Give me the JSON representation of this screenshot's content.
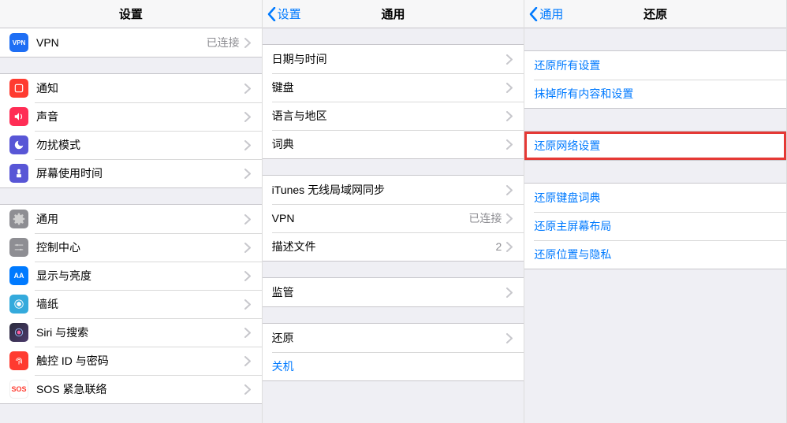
{
  "panel1": {
    "title": "设置",
    "group1": [
      {
        "name": "vpn",
        "label": "VPN",
        "detail": "已连接",
        "iconText": "VPN",
        "iconClass": "ic-vpn"
      }
    ],
    "group2": [
      {
        "name": "notifications",
        "label": "通知",
        "iconClass": "ic-notif"
      },
      {
        "name": "sounds",
        "label": "声音",
        "iconClass": "ic-sound"
      },
      {
        "name": "do-not-disturb",
        "label": "勿扰模式",
        "iconClass": "ic-dnd"
      },
      {
        "name": "screen-time",
        "label": "屏幕使用时间",
        "iconClass": "ic-screen"
      }
    ],
    "group3": [
      {
        "name": "general",
        "label": "通用",
        "iconClass": "ic-general"
      },
      {
        "name": "control-center",
        "label": "控制中心",
        "iconClass": "ic-control"
      },
      {
        "name": "display",
        "label": "显示与亮度",
        "iconText": "AA",
        "iconClass": "ic-display"
      },
      {
        "name": "wallpaper",
        "label": "墙纸",
        "iconClass": "ic-wall"
      },
      {
        "name": "siri",
        "label": "Siri 与搜索",
        "iconClass": "ic-siri"
      },
      {
        "name": "touchid",
        "label": "触控 ID 与密码",
        "iconClass": "ic-touchid"
      },
      {
        "name": "sos",
        "label": "SOS 紧急联络",
        "iconText": "SOS",
        "iconClass": "ic-sos"
      }
    ]
  },
  "panel2": {
    "back": "设置",
    "title": "通用",
    "groups": [
      [
        {
          "name": "date-time",
          "label": "日期与时间"
        },
        {
          "name": "keyboard",
          "label": "键盘"
        },
        {
          "name": "language-region",
          "label": "语言与地区"
        },
        {
          "name": "dictionary",
          "label": "词典"
        }
      ],
      [
        {
          "name": "itunes-wifi-sync",
          "label": "iTunes 无线局域网同步"
        },
        {
          "name": "vpn-general",
          "label": "VPN",
          "detail": "已连接"
        },
        {
          "name": "profiles",
          "label": "描述文件",
          "detail": "2"
        }
      ],
      [
        {
          "name": "supervision",
          "label": "监管"
        }
      ],
      [
        {
          "name": "reset",
          "label": "还原"
        },
        {
          "name": "shutdown",
          "label": "关机",
          "link": true,
          "noChevron": true
        }
      ]
    ]
  },
  "panel3": {
    "back": "通用",
    "title": "还原",
    "groups": [
      [
        {
          "name": "reset-all-settings",
          "label": "还原所有设置"
        },
        {
          "name": "erase-all",
          "label": "抹掉所有内容和设置"
        }
      ],
      [
        {
          "name": "reset-network",
          "label": "还原网络设置",
          "highlight": true
        }
      ],
      [
        {
          "name": "reset-keyboard-dict",
          "label": "还原键盘词典"
        },
        {
          "name": "reset-home-layout",
          "label": "还原主屏幕布局"
        },
        {
          "name": "reset-location-privacy",
          "label": "还原位置与隐私"
        }
      ]
    ]
  }
}
